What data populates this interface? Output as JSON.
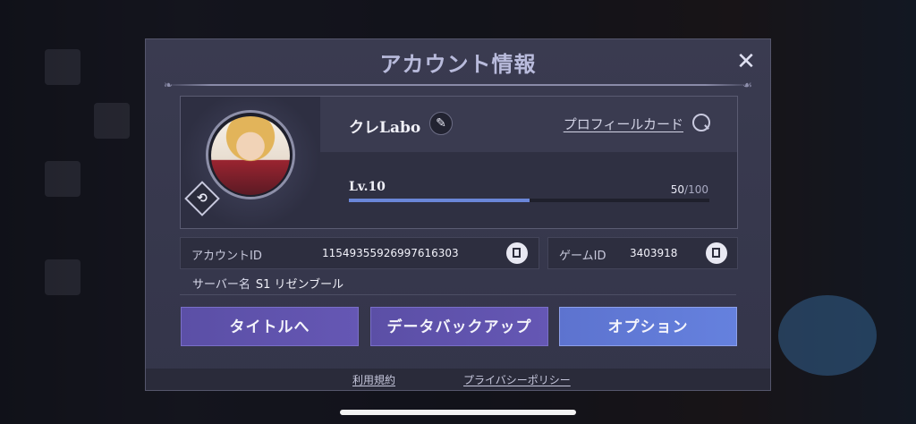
{
  "modal": {
    "title": "アカウント情報",
    "close_icon": "close-icon"
  },
  "profile": {
    "username": "クレLabo",
    "edit_icon": "pencil-icon",
    "profile_card_link": "プロフィールカード",
    "level": "Lv.10",
    "exp_current": "50",
    "exp_max": "/100",
    "exp_fraction": 0.5
  },
  "account": {
    "account_id_label": "アカウントID",
    "account_id_value": "11549355926997616303",
    "game_id_label": "ゲームID",
    "game_id_value": "3403918",
    "server_label": "サーバー名",
    "server_value": "S1 リゼンブール"
  },
  "buttons": {
    "title": "タイトルへ",
    "backup": "データバックアップ",
    "option": "オプション"
  },
  "footer": {
    "terms": "利用規約",
    "privacy": "プライバシーポリシー"
  },
  "colors": {
    "accent_purple": "#6557b4",
    "accent_blue": "#6581de",
    "exp_bar": "#6a86d8"
  }
}
